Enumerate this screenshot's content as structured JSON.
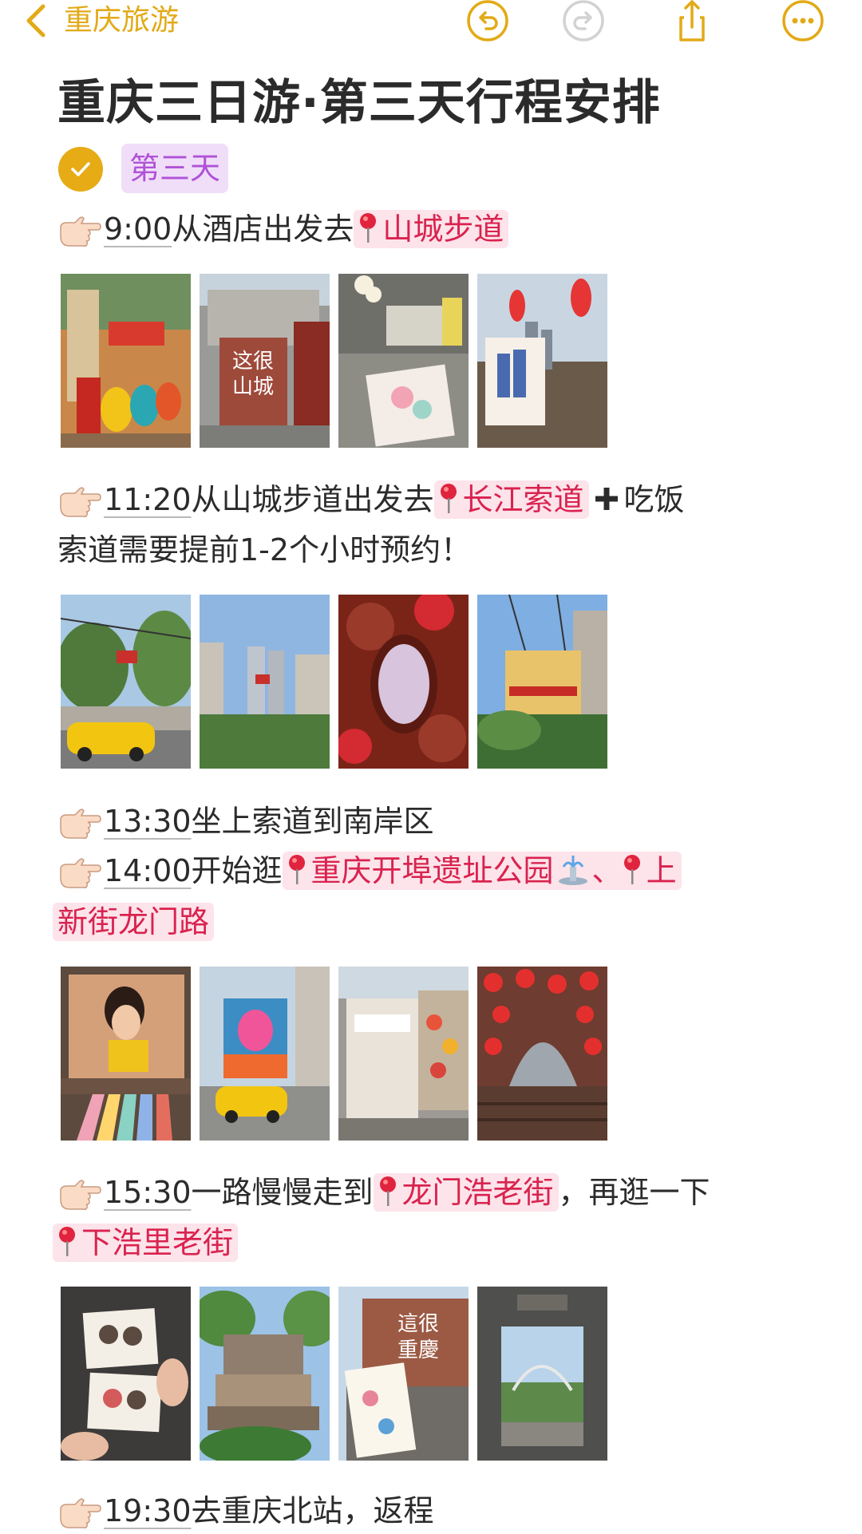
{
  "nav": {
    "back_label": "重庆旅游",
    "accent": "#e2aa17"
  },
  "note": {
    "title": "重庆三日游·第三天行程安排",
    "day_tag": "第三天",
    "day_tag_color": "#b052d6",
    "highlight_color": "#d9234f",
    "highlight_bg": "#fde3ea"
  },
  "schedule": [
    {
      "time": "9:00",
      "text": "从酒店出发去",
      "place": "山城步道"
    },
    {
      "time": "11:20",
      "text": "从山城步道出发去",
      "place": "长江索道",
      "after": "吃饭",
      "note": "索道需要提前1-2个小时预约！"
    },
    {
      "time": "13:30",
      "text": "坐上索道到南岸区"
    },
    {
      "time": "14:00",
      "text": "开始逛",
      "place": "重庆开埠遗址公园",
      "sep": "、",
      "place2_a": "上",
      "place2_b": "新街龙门路"
    },
    {
      "time": "15:30",
      "text": "一路慢慢走到",
      "place": "龙门浩老街",
      "mid": "，再逛一下",
      "place2": "下浩里老街"
    },
    {
      "time": "19:30",
      "text": "去重庆北站，返程"
    }
  ],
  "photo_sign_texts": {
    "s1": "这很山城",
    "s2": "這很重慶"
  },
  "icons": [
    "chevron-left-icon",
    "undo-icon",
    "redo-icon",
    "share-icon",
    "more-icon",
    "check-circle-icon",
    "pointing-hand-icon",
    "map-pin-icon",
    "plus-icon",
    "fountain-icon"
  ]
}
